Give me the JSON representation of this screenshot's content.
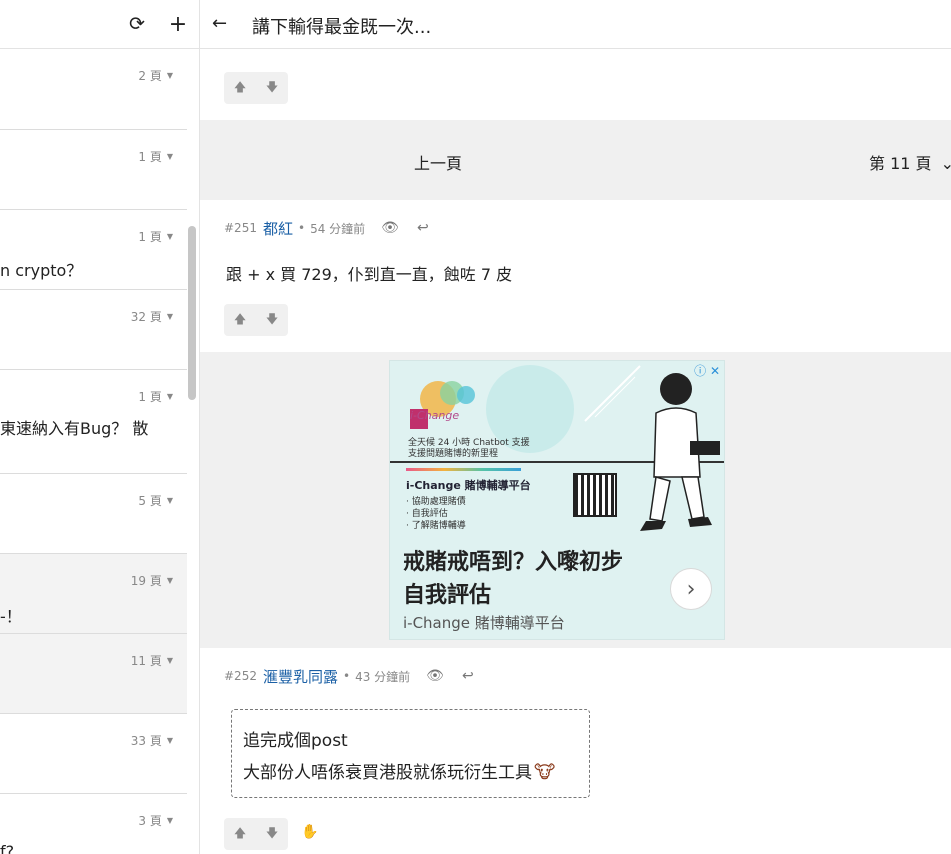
{
  "sidebar": {
    "refresh_icon": "⟳",
    "add_icon": "+",
    "threads": [
      {
        "pages": "2 頁",
        "title": "",
        "read": false
      },
      {
        "pages": "1 頁",
        "title": "",
        "read": false
      },
      {
        "pages": "1 頁",
        "title": "n crypto？",
        "read": false
      },
      {
        "pages": "32 頁",
        "title": "",
        "read": false
      },
      {
        "pages": "1 頁",
        "title": "東速納入有Bug？ 散",
        "read": false
      },
      {
        "pages": "5 頁",
        "title": "",
        "read": false
      },
      {
        "pages": "19 頁",
        "title": "‐！",
        "read": true
      },
      {
        "pages": "11 頁",
        "title": "",
        "read": true
      },
      {
        "pages": "33 頁",
        "title": "",
        "read": false
      },
      {
        "pages": "3 頁",
        "title": "f?",
        "read": false
      }
    ]
  },
  "topic": {
    "back_icon": "←",
    "title": "講下輸得最金既一次...",
    "vote_up": "🡅",
    "vote_down": "🡇",
    "pager": {
      "prev_label": "上一頁",
      "current_label": "第 11 頁",
      "chevron": "⌄"
    },
    "posts": [
      {
        "number": "#251",
        "author": "都紅",
        "separator": "•",
        "time": "54 分鐘前",
        "view_icon": "👁",
        "reply_icon": "↩",
        "content": "跟 + x 買 729，仆到直一直，蝕咗 7 皮"
      },
      {
        "number": "#252",
        "author": "滙豐乳同露",
        "separator": "•",
        "time": "43 分鐘前",
        "view_icon": "👁",
        "reply_icon": "↩",
        "content_line1": "追完成個post",
        "content_line2": "大部份人唔係衰買港股就係玩衍生工具",
        "content_emoji": "🐮",
        "hand_icon": "✋"
      }
    ]
  },
  "ad": {
    "close": "ⓘ ✕",
    "brand": "i-Change",
    "line1": "全天候 24 小時 Chatbot 支援",
    "line2": "支援問題賭博的新里程",
    "platform": "i-Change 賭博輔導平台",
    "bullets": [
      "· 協助處理賭債",
      "· 自我評估",
      "· 了解賭博輔導"
    ],
    "headline1": "戒賭戒唔到？入嚟初步",
    "headline2": "自我評估",
    "subline": "i-Change 賭博輔導平台",
    "next_icon": "›"
  }
}
